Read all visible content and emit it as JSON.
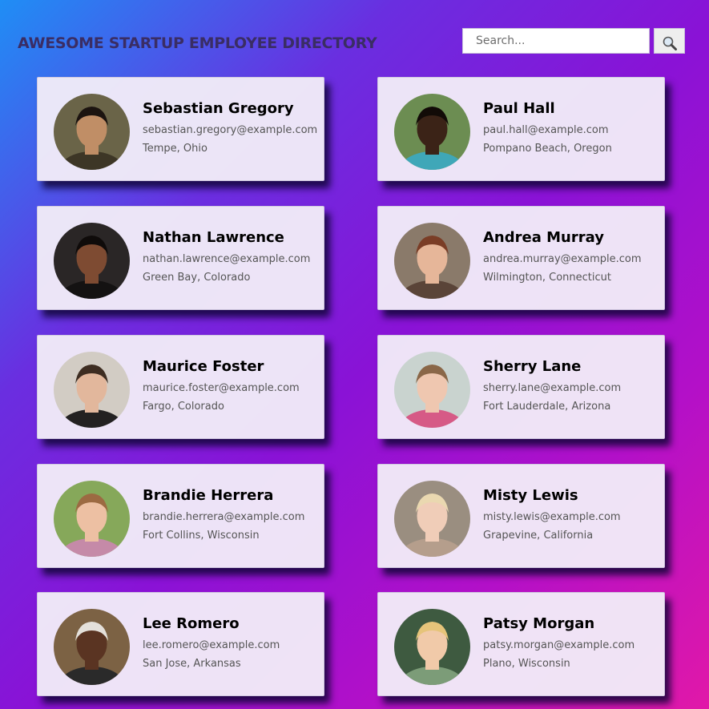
{
  "header": {
    "title": "AWESOME STARTUP EMPLOYEE DIRECTORY"
  },
  "search": {
    "placeholder": "Search...",
    "button_icon": "magnifier-icon"
  },
  "employees": [
    {
      "name": "Sebastian Gregory",
      "email": "sebastian.gregory@example.com",
      "location": "Tempe, Ohio",
      "photo": {
        "bg": "#6a6448",
        "skin": "#c08e66",
        "hair": "#1c1410",
        "shirt": "#3d3626"
      }
    },
    {
      "name": "Paul Hall",
      "email": "paul.hall@example.com",
      "location": "Pompano Beach, Oregon",
      "photo": {
        "bg": "#6c8d52",
        "skin": "#3b2317",
        "hair": "#120b07",
        "shirt": "#3fa7b8"
      }
    },
    {
      "name": "Nathan Lawrence",
      "email": "nathan.lawrence@example.com",
      "location": "Green Bay, Colorado",
      "photo": {
        "bg": "#2a2626",
        "skin": "#7e4b32",
        "hair": "#0f0b0a",
        "shirt": "#141212"
      }
    },
    {
      "name": "Andrea Murray",
      "email": "andrea.murray@example.com",
      "location": "Wilmington, Connecticut",
      "photo": {
        "bg": "#8a7a6a",
        "skin": "#e6b699",
        "hair": "#7a3d26",
        "shirt": "#5a4438"
      }
    },
    {
      "name": "Maurice Foster",
      "email": "maurice.foster@example.com",
      "location": "Fargo, Colorado",
      "photo": {
        "bg": "#d2ccc4",
        "skin": "#e2b79c",
        "hair": "#3e2d22",
        "shirt": "#232121"
      }
    },
    {
      "name": "Sherry Lane",
      "email": "sherry.lane@example.com",
      "location": "Fort Lauderdale, Arizona",
      "photo": {
        "bg": "#c9d3cf",
        "skin": "#efc7b0",
        "hair": "#8a6748",
        "shirt": "#d65a86"
      }
    },
    {
      "name": "Brandie Herrera",
      "email": "brandie.herrera@example.com",
      "location": "Fort Collins, Wisconsin",
      "photo": {
        "bg": "#86a85a",
        "skin": "#edc0a3",
        "hair": "#9c6a42",
        "shirt": "#c58aa8"
      }
    },
    {
      "name": "Misty Lewis",
      "email": "misty.lewis@example.com",
      "location": "Grapevine, California",
      "photo": {
        "bg": "#9a8e80",
        "skin": "#f0cdb8",
        "hair": "#ead8b0",
        "shirt": "#b59e8c"
      }
    },
    {
      "name": "Lee Romero",
      "email": "lee.romero@example.com",
      "location": "San Jose, Arkansas",
      "photo": {
        "bg": "#7c6244",
        "skin": "#5a3422",
        "hair": "#e4e0da",
        "shirt": "#2a2a2a"
      }
    },
    {
      "name": "Patsy Morgan",
      "email": "patsy.morgan@example.com",
      "location": "Plano, Wisconsin",
      "photo": {
        "bg": "#3e5a40",
        "skin": "#f1caa9",
        "hair": "#e6c47a",
        "shirt": "#7c9c78"
      }
    }
  ]
}
